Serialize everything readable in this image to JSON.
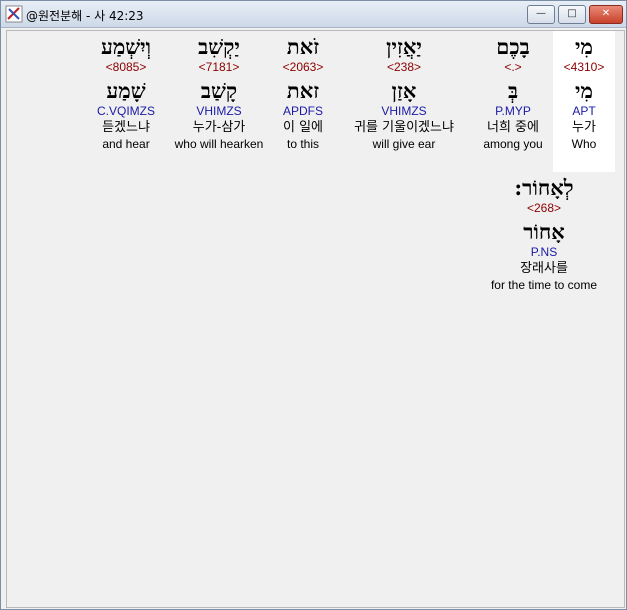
{
  "window": {
    "title": "@원전분해 - 사 42:23",
    "min_glyph": "—",
    "max_glyph": "□",
    "close_glyph": "✕",
    "accent": "#c9412c"
  },
  "words": [
    {
      "id": "mi",
      "hebrew": "מִי",
      "strong": "<4310>",
      "lemma": "מִי",
      "morph": "APT",
      "korean": "누가",
      "english": "Who"
    },
    {
      "id": "bakhem",
      "hebrew": "בָכֶם",
      "strong": "<.>",
      "lemma": "בְּ",
      "morph": "P.MYP",
      "korean": "너희 중에",
      "english": "among you"
    },
    {
      "id": "yaazin",
      "hebrew": "יַאֲזִין",
      "strong": "<238>",
      "lemma": "אָזַן",
      "morph": "VHIMZS",
      "korean": "귀를 기울이겠느냐",
      "english": "will give ear"
    },
    {
      "id": "zot",
      "hebrew": "זֹאת",
      "strong": "<2063>",
      "lemma": "זאת",
      "morph": "APDFS",
      "korean": "이 일에",
      "english": "to this"
    },
    {
      "id": "yaqshiv",
      "hebrew": "יַקְשִׁב",
      "strong": "<7181>",
      "lemma": "קָשַׁב",
      "morph": "VHIMZS",
      "korean": "누가-삼가",
      "english": "who will hearken"
    },
    {
      "id": "veyishma",
      "hebrew": "וְיִשְׁמַע",
      "strong": "<8085>",
      "lemma": "שָׁמַע",
      "morph": "C.VQIMZS",
      "korean": "듣겠느냐",
      "english": "and hear"
    },
    {
      "id": "leachor",
      "hebrew": "לְאָחוֹר:",
      "strong": "<268>",
      "lemma": "אָחוֹר",
      "morph": "P.NS",
      "korean": "장래사를",
      "english": "for the time to come"
    }
  ]
}
